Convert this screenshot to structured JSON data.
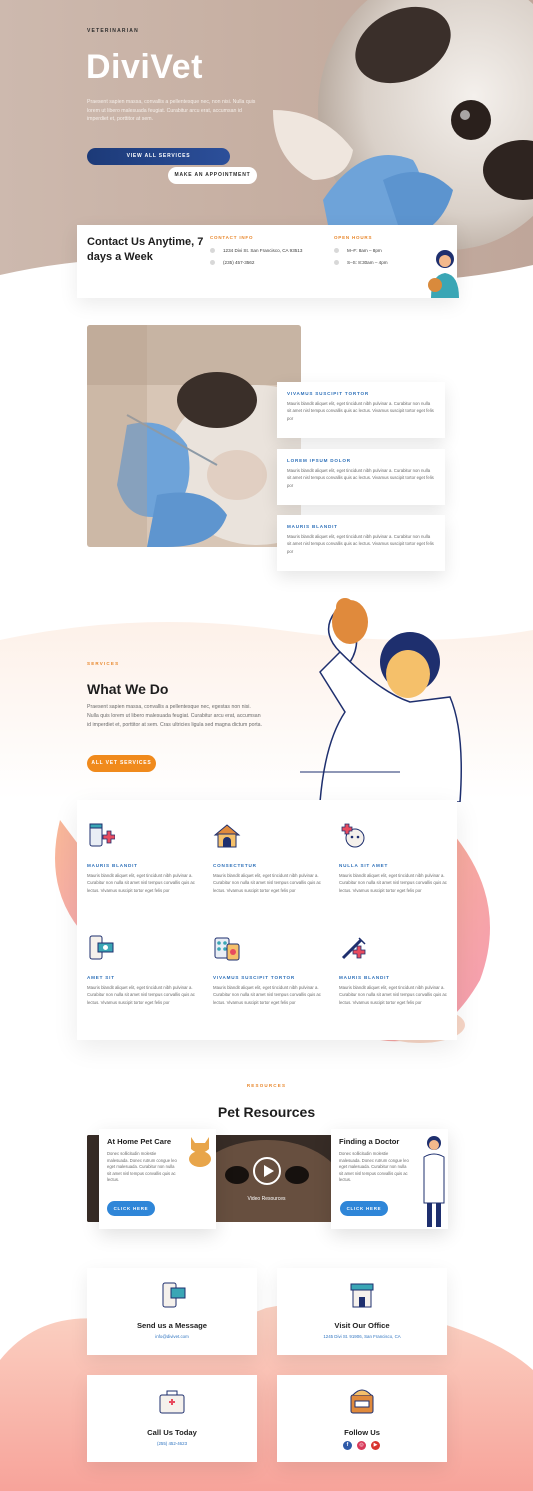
{
  "hero": {
    "eyebrow": "VETERINARIAN",
    "title": "DiviVet",
    "text": "Praesent sapien massa, convallis a pellentesque nec, non nisi. Nulla quis lorem ut libero malesuada feugiat. Curabitur arcu erat, accumsan id imperdiet et, porttitor at sem.",
    "btn_services": "VIEW ALL SERVICES",
    "btn_appointment": "MAKE AN APPOINTMENT"
  },
  "contact_bar": {
    "title": "Contact Us Anytime, 7 days a Week",
    "info_head": "CONTACT INFO",
    "address": "1234 Divi St. San Francisco, CA 93513",
    "phone": "(235) 457-3562",
    "hours_head": "OPEN HOURS",
    "hours1": "M–F: 8am – 8pm",
    "hours2": "S–S: 8:30am – 4pm"
  },
  "features": [
    {
      "title": "VIVAMUS SUSCIPIT TORTOR",
      "text": "Mauris blandit aliquet elit, eget tincidunt nibh pulvinar a. Curabitur non nulla sit amet nisl tempus convallis quis ac lectus. Vivamus suscipit tortor eget felis por"
    },
    {
      "title": "LOREM IPSUM DOLOR",
      "text": "Mauris blandit aliquet elit, eget tincidunt nibh pulvinar a. Curabitur non nulla sit amet nisl tempus convallis quis ac lectus. Vivamus suscipit tortor eget felis por"
    },
    {
      "title": "MAURIS BLANDIT",
      "text": "Mauris blandit aliquet elit, eget tincidunt nibh pulvinar a. Curabitur non nulla sit amet nisl tempus convallis quis ac lectus. Vivamus suscipit tortor eget felis por"
    }
  ],
  "services": {
    "eyebrow": "SERVICES",
    "title": "What We Do",
    "text": "Praesent sapien massa, convallis a pellentesque nec, egestas non nisi. Nulla quis lorem ut libero malesuada feugiat. Curabitur arcu erat, accumsan id imperdiet et, porttitor at sem. Cras ultricies ligula sed magna dictum porta.",
    "button": "ALL VET SERVICES",
    "items": [
      {
        "title": "MAURIS BLANDIT",
        "text": "Mauris blandit aliquet elit, eget tincidunt nibh pulvinar a. Curabitur non nulla sit amet nisl tempus convallis quis ac lectus. Vivamus suscipit tortor eget felis por",
        "icon": "medicine-bottle-icon"
      },
      {
        "title": "CONSECTETUR",
        "text": "Mauris blandit aliquet elit, eget tincidunt nibh pulvinar a. Curabitur non nulla sit amet nisl tempus convallis quis ac lectus. Vivamus suscipit tortor eget felis por",
        "icon": "dog-house-icon"
      },
      {
        "title": "NULLA SIT AMET",
        "text": "Mauris blandit aliquet elit, eget tincidunt nibh pulvinar a. Curabitur non nulla sit amet nisl tempus convallis quis ac lectus. Vivamus suscipit tortor eget felis por",
        "icon": "dog-medical-icon"
      },
      {
        "title": "AMET SIT",
        "text": "Mauris blandit aliquet elit, eget tincidunt nibh pulvinar a. Curabitur non nulla sit amet nisl tempus convallis quis ac lectus. Vivamus suscipit tortor eget felis por",
        "icon": "phone-money-icon"
      },
      {
        "title": "VIVAMUS SUSCIPIT TORTOR",
        "text": "Mauris blandit aliquet elit, eget tincidunt nibh pulvinar a. Curabitur non nulla sit amet nisl tempus convallis quis ac lectus. Vivamus suscipit tortor eget felis por",
        "icon": "pills-icon"
      },
      {
        "title": "MAURIS BLANDIT",
        "text": "Mauris blandit aliquet elit, eget tincidunt nibh pulvinar a. Curabitur non nulla sit amet nisl tempus convallis quis ac lectus. Vivamus suscipit tortor eget felis por",
        "icon": "syringe-icon"
      }
    ]
  },
  "resources": {
    "eyebrow": "RESOURCES",
    "title": "Pet Resources",
    "video_label": "Video Resources",
    "card1_title": "At Home Pet Care",
    "card1_text": "Donec sollicitudin molestie malesuada. Donec rutrum congue leo eget malesuada. Curabitur non nulla sit amet nisl tempus convallis quis ac lectus.",
    "card2_title": "Finding a Doctor",
    "card2_text": "Donec sollicitudin molestie malesuada. Donec rutrum congue leo eget malesuada. Curabitur non nulla sit amet nisl tempus convallis quis ac lectus.",
    "click_here": "CLICK HERE"
  },
  "contact_cards": {
    "message_title": "Send us a Message",
    "message_sub": "info@divivet.com",
    "office_title": "Visit Our Office",
    "office_sub": "1245 Divi St. 91906, San Francisco, CA",
    "call_title": "Call Us Today",
    "call_sub": "(255) 452-4623",
    "follow_title": "Follow Us"
  },
  "colors": {
    "accent_orange": "#f08a1c",
    "accent_blue": "#2f86d8",
    "navy": "#1c3a78"
  }
}
